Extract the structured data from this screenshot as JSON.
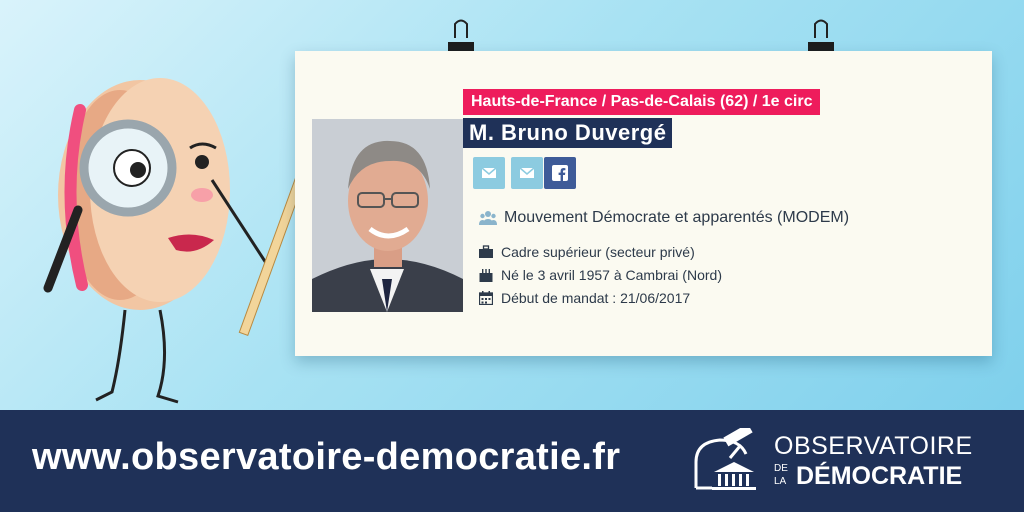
{
  "card": {
    "region": "Hauts-de-France / Pas-de-Calais (62) / 1e circ",
    "name": "M. Bruno Duvergé",
    "photo_alt": "portrait",
    "buttons": [
      {
        "icon": "envelope-icon"
      },
      {
        "icon": "envelope-icon"
      },
      {
        "icon": "facebook-icon"
      }
    ],
    "group": {
      "icon": "users-icon",
      "text": "Mouvement Démocrate et apparentés (MODEM)"
    },
    "details": [
      {
        "icon": "briefcase-icon",
        "text": "Cadre supérieur (secteur privé)"
      },
      {
        "icon": "birthday-cake-icon",
        "text": "Né le 3 avril 1957 à Cambrai (Nord)"
      },
      {
        "icon": "calendar-icon",
        "text": "Début de mandat : 21/06/2017"
      }
    ]
  },
  "footer": {
    "url": "www.observatoire-democratie.fr",
    "logo": {
      "line1": "OBSERVATOIRE",
      "de": "DE",
      "la": "LA",
      "line2": "DÉMOCRATIE"
    }
  },
  "colors": {
    "region_bg": "#ee1c5c",
    "name_bg": "#1f3158",
    "footer_bg": "#1f3158",
    "email_btn": "#8ccbe0",
    "facebook_btn": "#3e5b98"
  }
}
